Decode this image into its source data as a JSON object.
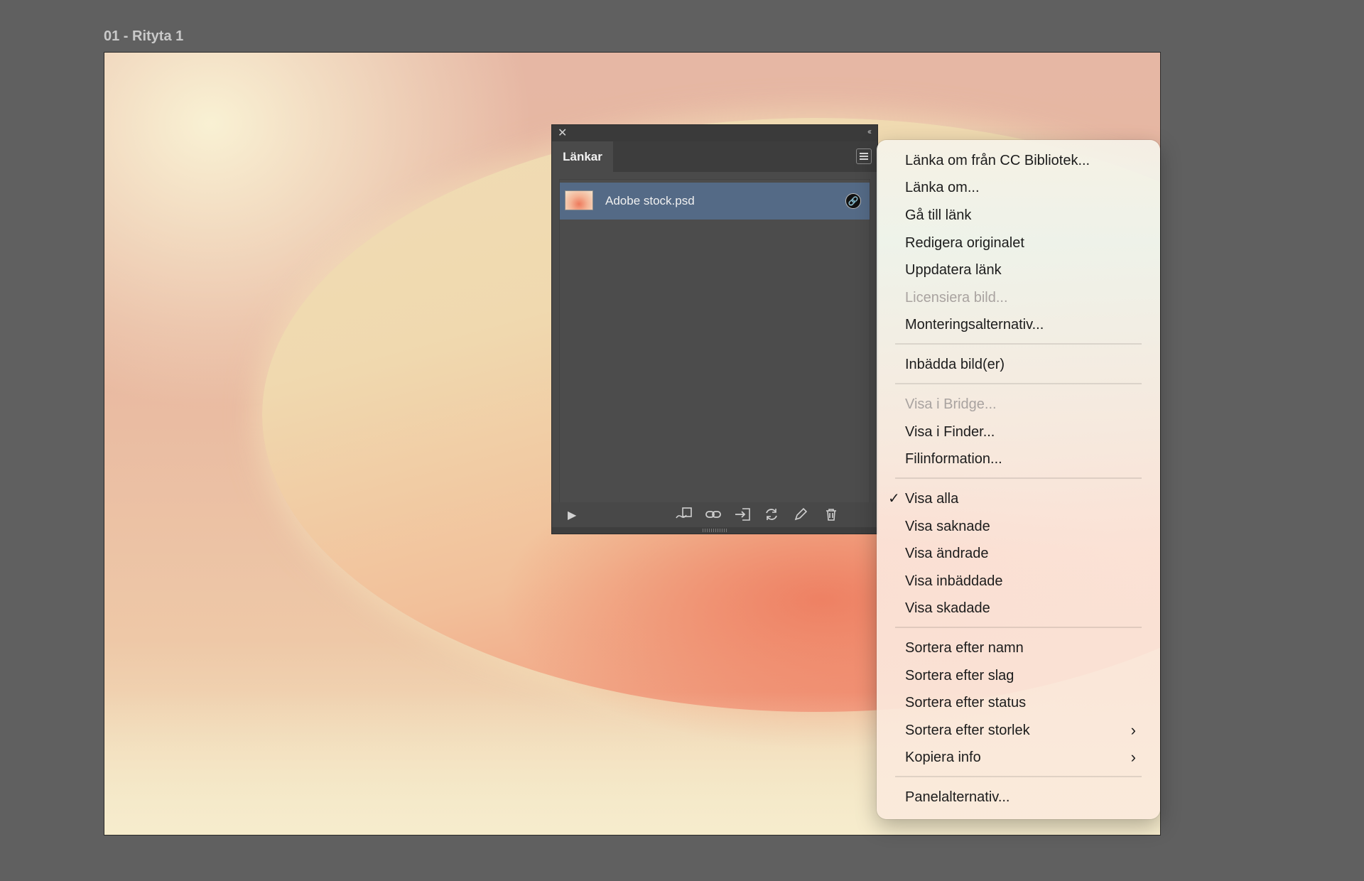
{
  "artboard": {
    "label": "01 - Rityta 1"
  },
  "panel": {
    "tab_label": "Länkar",
    "close_glyph": "✕",
    "collapse_glyph": "‹‹",
    "links": [
      {
        "name": "Adobe stock.psd",
        "status_icon": "link-icon"
      }
    ],
    "footer_icons": [
      "relink-from-cc-library-icon",
      "relink-icon",
      "go-to-link-icon",
      "update-link-icon",
      "edit-original-icon",
      "delete-icon"
    ]
  },
  "menu": {
    "items": [
      {
        "label": "Länka om från CC Bibliotek...",
        "enabled": true
      },
      {
        "label": "Länka om...",
        "enabled": true
      },
      {
        "label": "Gå till länk",
        "enabled": true
      },
      {
        "label": "Redigera originalet",
        "enabled": true
      },
      {
        "label": "Uppdatera länk",
        "enabled": true
      },
      {
        "label": "Licensiera bild...",
        "enabled": false
      },
      {
        "label": "Monteringsalternativ...",
        "enabled": true
      },
      {
        "label": "Inbädda bild(er)",
        "enabled": true
      },
      {
        "label": "Visa i Bridge...",
        "enabled": false
      },
      {
        "label": "Visa i Finder...",
        "enabled": true
      },
      {
        "label": "Filinformation...",
        "enabled": true
      },
      {
        "label": "Visa alla",
        "enabled": true,
        "checked": true,
        "check_glyph": "✓"
      },
      {
        "label": "Visa saknade",
        "enabled": true
      },
      {
        "label": "Visa ändrade",
        "enabled": true
      },
      {
        "label": "Visa inbäddade",
        "enabled": true
      },
      {
        "label": "Visa skadade",
        "enabled": true
      },
      {
        "label": "Sortera efter namn",
        "enabled": true
      },
      {
        "label": "Sortera efter slag",
        "enabled": true
      },
      {
        "label": "Sortera efter status",
        "enabled": true
      },
      {
        "label": "Sortera efter storlek",
        "enabled": true,
        "submenu": true
      },
      {
        "label": "Kopiera info",
        "enabled": true,
        "submenu": true
      },
      {
        "label": "Panelalternativ...",
        "enabled": true
      }
    ]
  }
}
